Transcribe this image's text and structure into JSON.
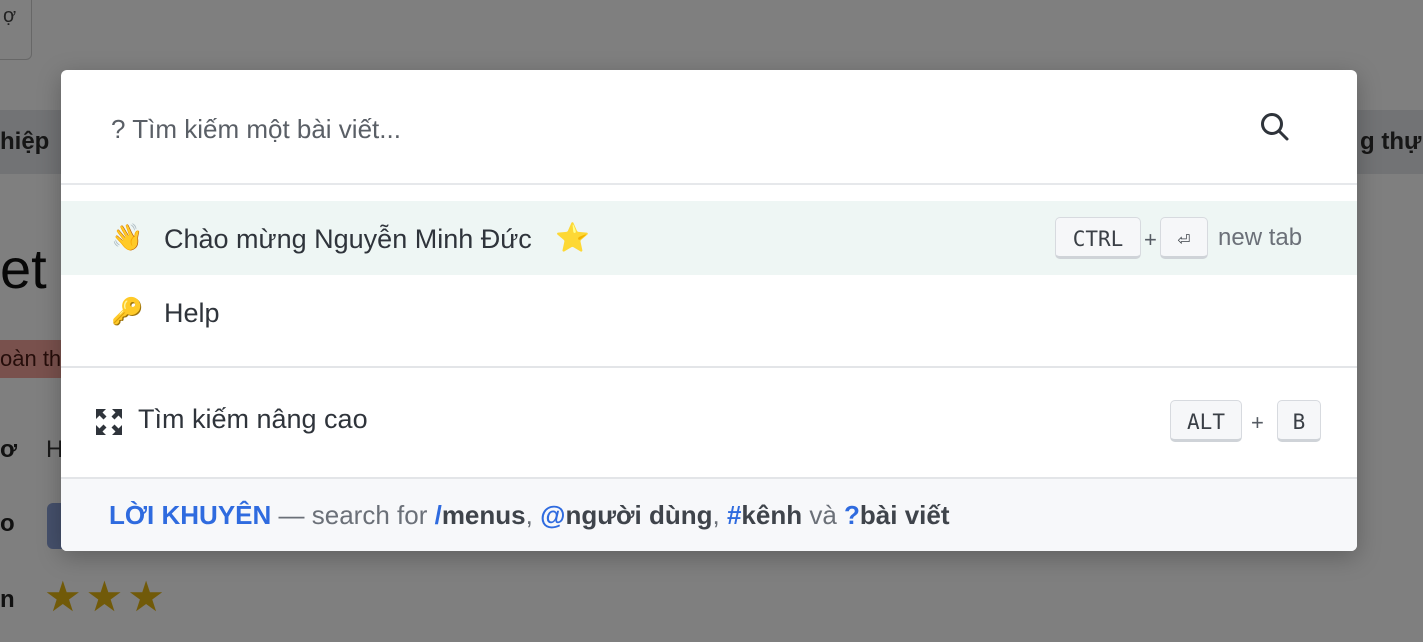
{
  "background": {
    "top_box_text": "ợ",
    "nav_left": "hiệp",
    "nav_right": "g thự",
    "title": "et C",
    "tag": "oàn th",
    "rows": [
      {
        "label": "ơ",
        "value": "H"
      },
      {
        "label": "o",
        "value": ""
      },
      {
        "label": "n",
        "value": ""
      }
    ],
    "stars": "★★★"
  },
  "search": {
    "placeholder": "? Tìm kiếm một bài viết...",
    "value": ""
  },
  "results": [
    {
      "emoji": "👋",
      "label": "Chào mừng Nguyễn Minh Đức",
      "star": "⭐",
      "shortcut": {
        "key1": "CTRL",
        "plus": "+",
        "key2": "⏎",
        "hint": "new tab"
      }
    },
    {
      "emoji": "🔑",
      "label": "Help"
    }
  ],
  "advanced": {
    "label": "Tìm kiếm nâng cao",
    "shortcut": {
      "key1": "ALT",
      "plus": "+",
      "key2": "B"
    }
  },
  "tip": {
    "title": "LỜI KHUYÊN",
    "intro": " — search for ",
    "items": [
      {
        "prefix": "/",
        "word": "menus"
      },
      {
        "prefix": "@",
        "word": "người dùng"
      },
      {
        "prefix": "#",
        "word": "kênh"
      },
      {
        "prefix": "?",
        "word": "bài viết"
      }
    ],
    "sep": ", ",
    "and": " và "
  },
  "colors": {
    "accent": "#2f6bdf",
    "active_row": "#eef6f4",
    "overlay": "rgba(0,0,0,0.5)"
  }
}
